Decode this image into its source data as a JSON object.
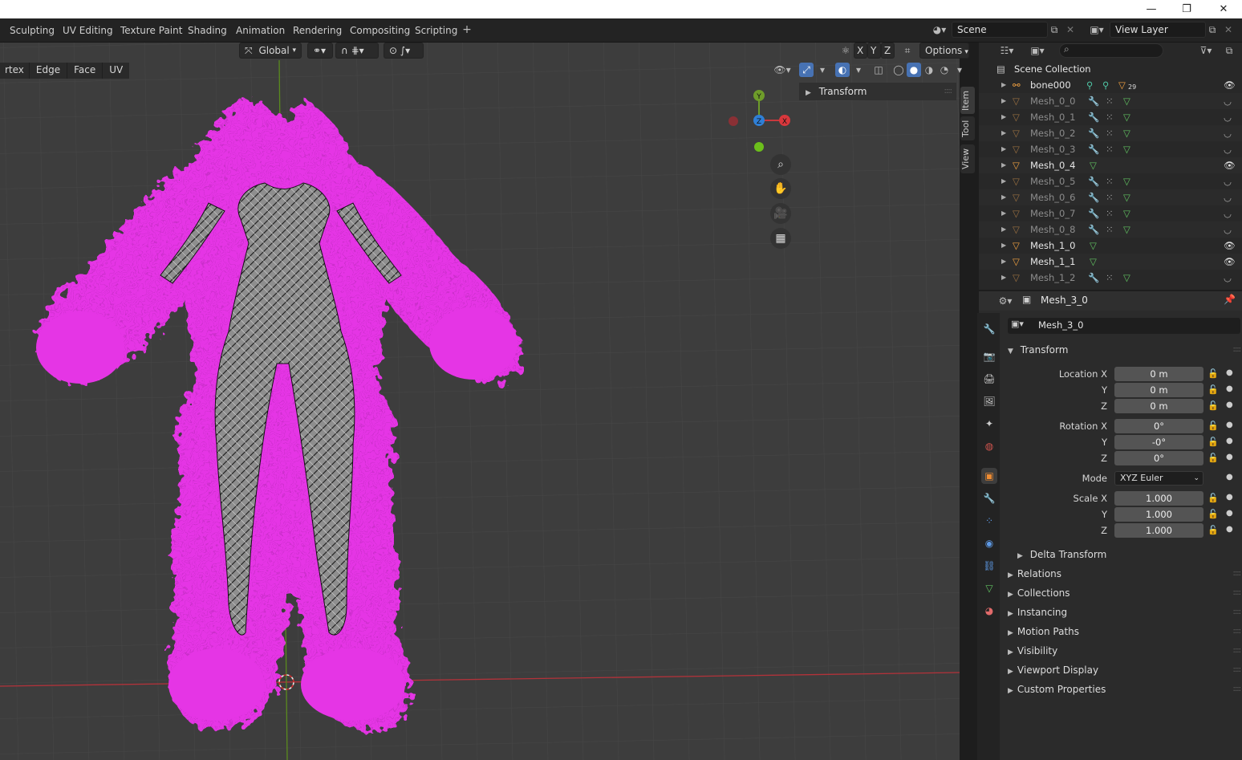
{
  "window": {
    "minimize_glyph": "—",
    "restore_glyph": "❐",
    "close_glyph": "✕"
  },
  "workspace_tabs": [
    "Sculpting",
    "UV Editing",
    "Texture Paint",
    "Shading",
    "Animation",
    "Rendering",
    "Compositing",
    "Scripting"
  ],
  "scene": {
    "name": "Scene",
    "view_layer": "View Layer"
  },
  "viewport": {
    "transform_orientation": "Global",
    "select_modes": [
      "rtex",
      "Edge",
      "Face",
      "UV"
    ],
    "axis_toggles": [
      "X",
      "Y",
      "Z"
    ],
    "options_label": "Options",
    "npanel": {
      "transform_label": "Transform",
      "tabs": [
        "Item",
        "Tool",
        "View"
      ]
    },
    "gizmo": {
      "x": "X",
      "y": "Y",
      "z": "Z"
    },
    "colors": {
      "background": "#3d3d3d",
      "normals": "#e535e5",
      "mesh": "#9a9a9a",
      "x_axis": "#c23a3a",
      "y_axis": "#5a8a1e"
    }
  },
  "outliner": {
    "search_placeholder": "",
    "root": "Scene Collection",
    "items": [
      {
        "name": "bone000",
        "state": "visible",
        "badge": "29"
      },
      {
        "name": "Mesh_0_0",
        "state": "hidden"
      },
      {
        "name": "Mesh_0_1",
        "state": "hidden"
      },
      {
        "name": "Mesh_0_2",
        "state": "hidden"
      },
      {
        "name": "Mesh_0_3",
        "state": "hidden"
      },
      {
        "name": "Mesh_0_4",
        "state": "visible"
      },
      {
        "name": "Mesh_0_5",
        "state": "hidden"
      },
      {
        "name": "Mesh_0_6",
        "state": "hidden"
      },
      {
        "name": "Mesh_0_7",
        "state": "hidden"
      },
      {
        "name": "Mesh_0_8",
        "state": "hidden"
      },
      {
        "name": "Mesh_1_0",
        "state": "visible"
      },
      {
        "name": "Mesh_1_1",
        "state": "visible"
      },
      {
        "name": "Mesh_1_2",
        "state": "hidden"
      }
    ]
  },
  "properties": {
    "header_object": "Mesh_3_0",
    "object_name": "Mesh_3_0",
    "transform": {
      "title": "Transform",
      "location": {
        "label": "Location X",
        "x": "0 m",
        "y": "0 m",
        "z": "0 m"
      },
      "rotation": {
        "label": "Rotation X",
        "x": "0°",
        "y": "-0°",
        "z": "0°"
      },
      "mode_label": "Mode",
      "mode_value": "XYZ Euler",
      "scale": {
        "label": "Scale X",
        "x": "1.000",
        "y": "1.000",
        "z": "1.000"
      },
      "axis_labels": {
        "y": "Y",
        "z": "Z"
      },
      "delta": "Delta Transform"
    },
    "sections": [
      "Relations",
      "Collections",
      "Instancing",
      "Motion Paths",
      "Visibility",
      "Viewport Display",
      "Custom Properties"
    ]
  }
}
